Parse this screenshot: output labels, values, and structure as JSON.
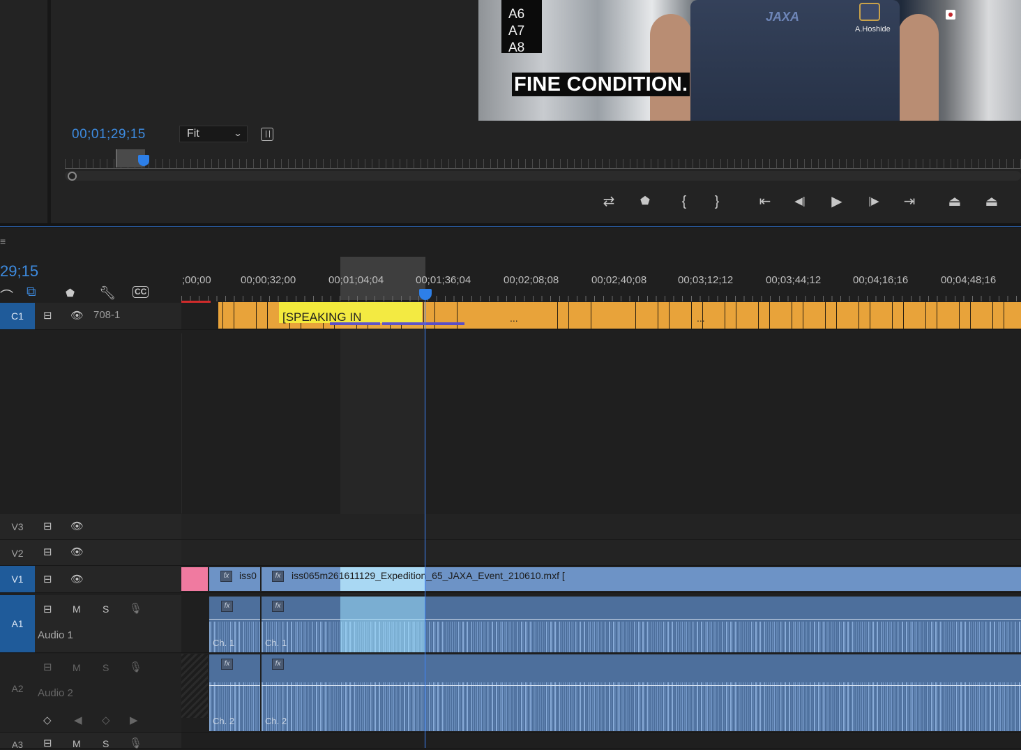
{
  "program_monitor": {
    "caption_overlay": "FINE CONDITION.",
    "channel_list": [
      "A6",
      "A7",
      "A8"
    ],
    "shirt_logo": "JAXA",
    "name_tag": "A.Hoshide",
    "timecode": "00;01;29;15",
    "zoom": "Fit",
    "transport_buttons": [
      {
        "name": "insert-button",
        "icon": "insert-icon",
        "glyph": "⇄"
      },
      {
        "name": "add-marker-button",
        "icon": "marker-icon",
        "glyph": "⬟"
      },
      {
        "name": "mark-in-button",
        "icon": "mark-in-icon",
        "glyph": "{"
      },
      {
        "name": "mark-out-button",
        "icon": "mark-out-icon",
        "glyph": "}"
      },
      {
        "name": "go-to-in-button",
        "icon": "go-to-in-icon",
        "glyph": "⇤"
      },
      {
        "name": "step-back-button",
        "icon": "step-back-icon",
        "glyph": "◀|"
      },
      {
        "name": "play-button",
        "icon": "play-icon",
        "glyph": "▶"
      },
      {
        "name": "step-forward-button",
        "icon": "step-forward-icon",
        "glyph": "|▶"
      },
      {
        "name": "go-to-out-button",
        "icon": "go-to-out-icon",
        "glyph": "⇥"
      },
      {
        "name": "lift-button",
        "icon": "lift-icon",
        "glyph": "⏏"
      },
      {
        "name": "extract-button",
        "icon": "extract-icon",
        "glyph": "⏏"
      }
    ]
  },
  "timeline": {
    "menu_glyph": "≡",
    "timecode": "29;15",
    "ruler_labels": [
      ";00;00",
      "00;00;32;00",
      "00;01;04;04",
      "00;01;36;04",
      "00;02;08;08",
      "00;02;40;08",
      "00;03;12;12",
      "00;03;44;12",
      "00;04;16;16",
      "00;04;48;16"
    ],
    "tools": {
      "snap": "snap-icon",
      "linked": "linked-selection-icon",
      "marker": "marker-icon",
      "settings": "wrench-icon",
      "captions": "CC"
    },
    "tracks": {
      "c1": {
        "id": "C1",
        "name": "708-1",
        "caption_text": "[SPEAKING IN",
        "ellipsis": "..."
      },
      "v3": {
        "id": "V3"
      },
      "v2": {
        "id": "V2"
      },
      "v1": {
        "id": "V1",
        "clip_short": "iss0",
        "clip_name": "iss065m261611129_Expedition_65_JAXA_Event_210610.mxf ["
      },
      "a1": {
        "id": "A1",
        "name": "Audio 1",
        "mute": "M",
        "solo": "S",
        "channel": "Ch. 1"
      },
      "a2": {
        "id": "A2",
        "name": "Audio 2",
        "mute": "M",
        "solo": "S",
        "channel": "Ch. 2"
      },
      "a3": {
        "id": "A3",
        "mute": "M",
        "solo": "S"
      }
    },
    "fx_label": "fx"
  },
  "colors": {
    "accent": "#2d7fe8",
    "caption_clip": "#e8a33a",
    "caption_highlight": "#f3ea3c",
    "video_clip": "#6d93c6",
    "audio_clip": "#4d6f9c"
  }
}
